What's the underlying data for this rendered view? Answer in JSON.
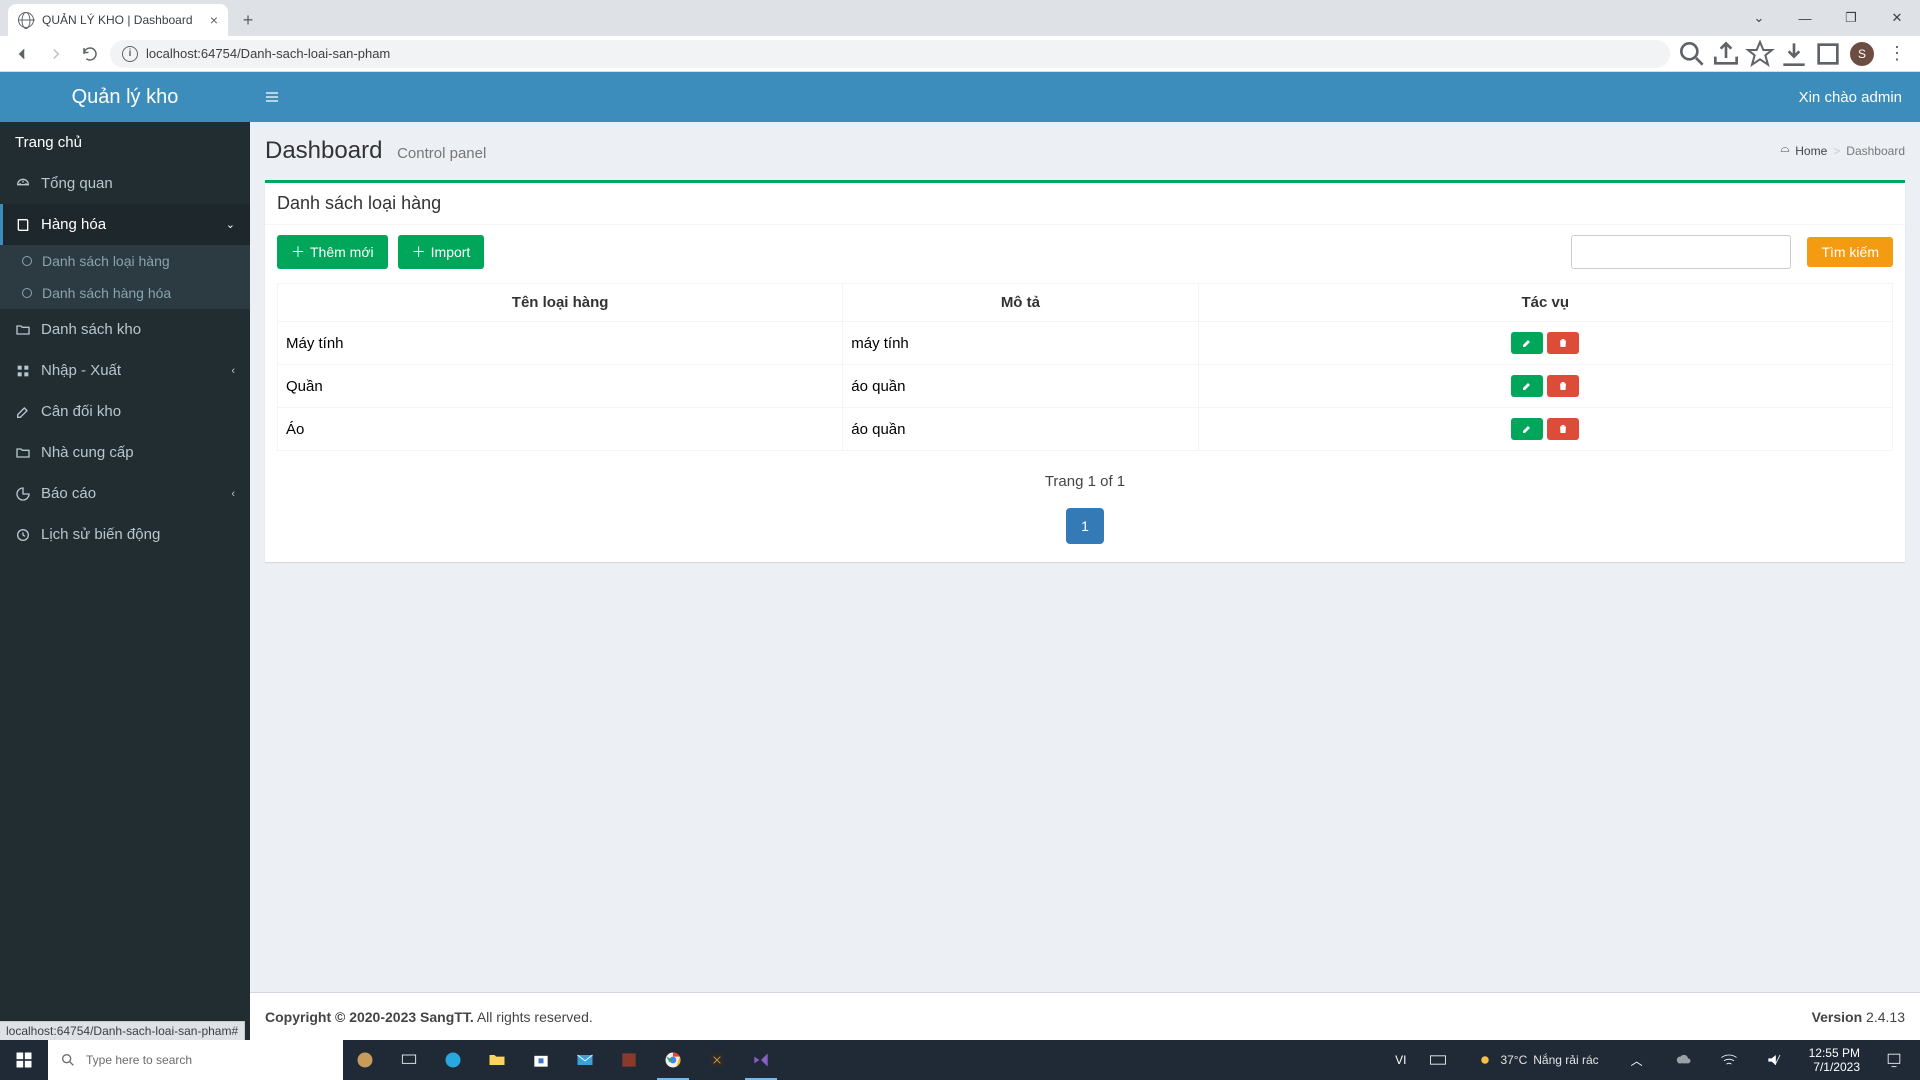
{
  "browser": {
    "tab_title": "QUẢN LÝ KHO | Dashboard",
    "url": "localhost:64754/Danh-sach-loai-san-pham",
    "status_url": "localhost:64754/Danh-sach-loai-san-pham#",
    "avatar_letter": "S"
  },
  "header": {
    "logo": "Quản lý kho",
    "welcome": "Xin chào admin"
  },
  "sidebar": {
    "home": "Trang chủ",
    "overview": "Tổng quan",
    "goods": "Hàng hóa",
    "goods_sub": {
      "types": "Danh sách loại hàng",
      "items": "Danh sách hàng hóa"
    },
    "warehouses": "Danh sách kho",
    "io": "Nhập - Xuất",
    "balance": "Cân đối kho",
    "suppliers": "Nhà cung cấp",
    "reports": "Báo cáo",
    "history": "Lịch sử biến động"
  },
  "page": {
    "title": "Dashboard",
    "subtitle": "Control panel",
    "breadcrumb_home": "Home",
    "breadcrumb_current": "Dashboard"
  },
  "box": {
    "title": "Danh sách loại hàng",
    "btn_add": "Thêm mới",
    "btn_import": "Import",
    "btn_search": "Tìm kiếm",
    "search_value": "",
    "columns": {
      "name": "Tên loại hàng",
      "desc": "Mô tả",
      "actions": "Tác vụ"
    },
    "rows": [
      {
        "name": "Máy tính",
        "desc": "máy tính"
      },
      {
        "name": "Quần",
        "desc": "áo quần"
      },
      {
        "name": "Áo",
        "desc": "áo quần"
      }
    ],
    "page_info": "Trang 1 of 1",
    "page_number": "1"
  },
  "footer": {
    "copyright": "Copyright © 2020-2023 SangTT.",
    "rights": " All rights reserved.",
    "version_label": "Version",
    "version": " 2.4.13"
  },
  "taskbar": {
    "search_placeholder": "Type here to search",
    "lang": "VI",
    "temp": "37°C",
    "weather": " Nắng rải rác",
    "time": "12:55 PM",
    "date": "7/1/2023"
  }
}
